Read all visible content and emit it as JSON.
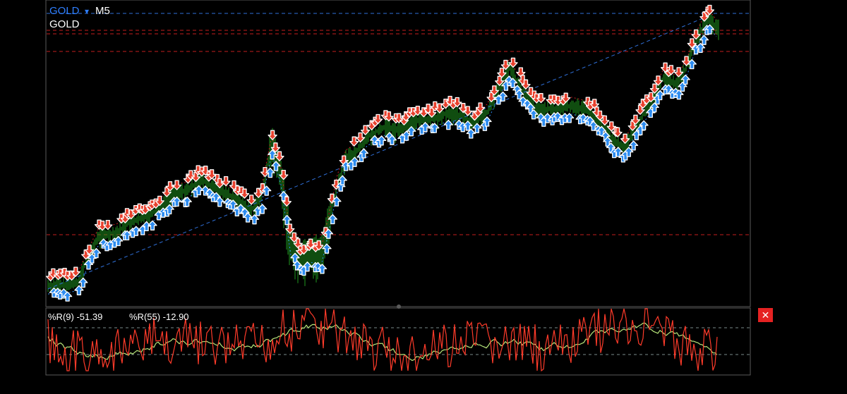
{
  "header": {
    "symbol": "GOLD",
    "symbol_dropdown_glyph": "▾",
    "timeframe": "M5",
    "series_label": "GOLD"
  },
  "indicator": {
    "wr_fast_label": "%R(9) -51.39",
    "wr_slow_label": "%R(55) -12.90",
    "close_glyph": "✕"
  },
  "colors": {
    "background": "#000000",
    "panel_border": "#5a5a5a",
    "symbol_blue": "#2f7fff",
    "trend_line": "#2f6fd8",
    "level_red": "#c41e1e",
    "candle_green": "#1f9a1f",
    "sell_arrow": "#e8412e",
    "buy_arrow": "#2d8cf0",
    "wr_fast": "#ff3b2a",
    "wr_slow": "#b7e67a",
    "text": "#ffffff",
    "close_bg": "#e52222"
  },
  "icons": {
    "sell": "down-arrow-icon",
    "buy": "up-arrow-icon",
    "close": "close-icon",
    "dropdown": "chevron-down-icon"
  }
}
